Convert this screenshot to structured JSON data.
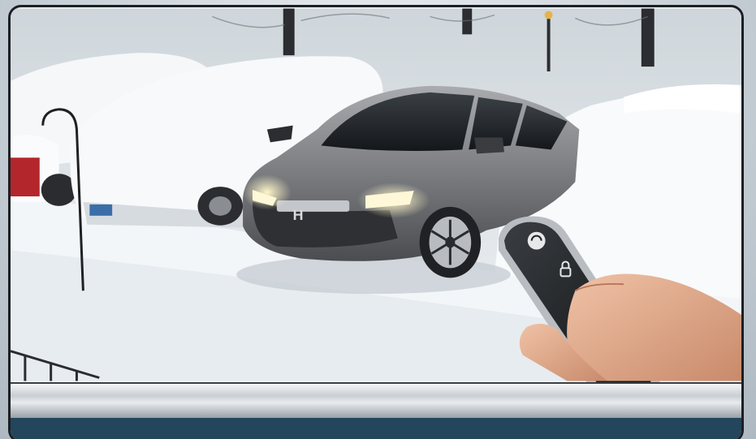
{
  "scene": {
    "description_icons": [
      "snow-scene",
      "car",
      "key-fob",
      "hand"
    ],
    "colors": {
      "snow": "#f2f5f8",
      "car_body": "#7d7f83",
      "frame": "#1c1f24",
      "bottom_bar": "#23465d"
    }
  }
}
